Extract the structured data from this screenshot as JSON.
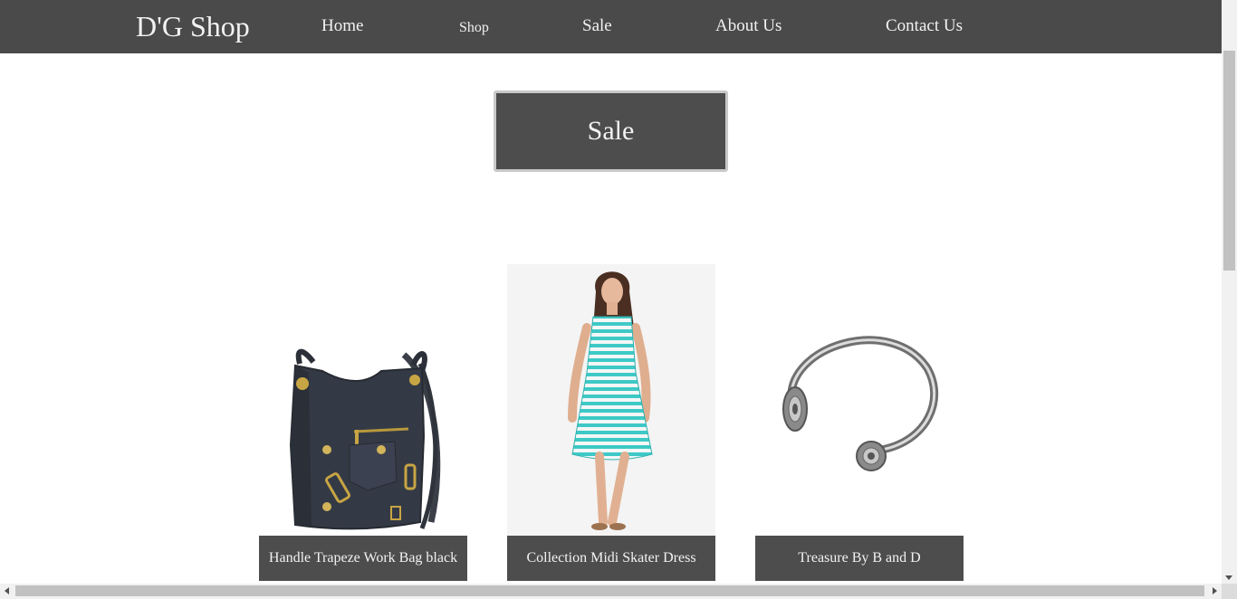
{
  "colors": {
    "navbar_bg": "#4a4a4a",
    "box_bg": "#4d4d4d",
    "box_border": "#c9c9c9",
    "text_light": "#f2f2f2",
    "page_bg": "#ffffff"
  },
  "nav": {
    "brand": "D'G Shop",
    "links": [
      {
        "label": "Home"
      },
      {
        "label": "Shop"
      },
      {
        "label": "Sale"
      },
      {
        "label": "About Us"
      },
      {
        "label": "Contact Us"
      }
    ]
  },
  "main": {
    "heading": "Sale",
    "products": [
      {
        "name": "Handle Trapeze Work Bag black",
        "image_icon": "handbag-image"
      },
      {
        "name": "Collection Midi Skater Dress",
        "image_icon": "dress-image"
      },
      {
        "name": "Treasure By B and D",
        "image_icon": "bracelet-image"
      }
    ]
  }
}
